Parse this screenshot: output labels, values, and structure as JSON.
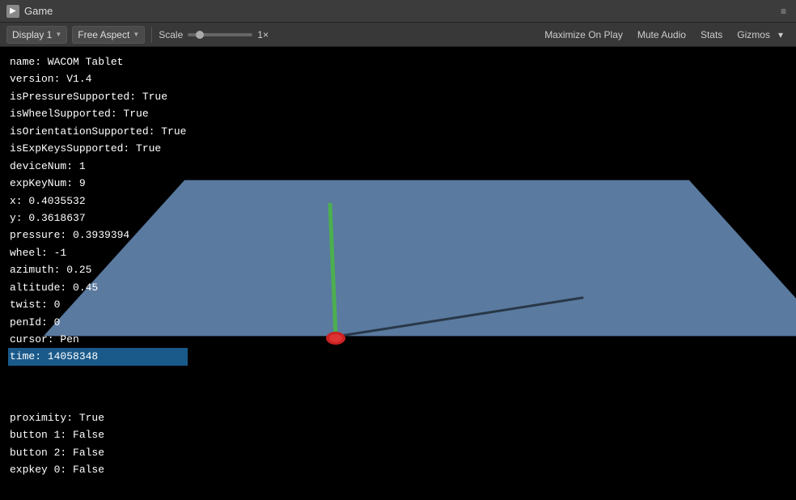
{
  "titleBar": {
    "icon": "▶",
    "title": "Game",
    "controls": "≡"
  },
  "toolbar": {
    "display": "Display 1",
    "aspect": "Free Aspect",
    "scaleLabel": "Scale",
    "scaleValue": "1×",
    "buttons": [
      "Maximize On Play",
      "Mute Audio",
      "Stats",
      "Gizmos"
    ]
  },
  "debugLines": [
    {
      "text": "name: WACOM Tablet",
      "highlighted": false
    },
    {
      "text": "version: V1.4",
      "highlighted": false
    },
    {
      "text": "isPressureSupported: True",
      "highlighted": false
    },
    {
      "text": "isWheelSupported: True",
      "highlighted": false
    },
    {
      "text": "isOrientationSupported: True",
      "highlighted": false
    },
    {
      "text": "isExpKeysSupported: True",
      "highlighted": false
    },
    {
      "text": "deviceNum: 1",
      "highlighted": false
    },
    {
      "text": "expKeyNum: 9",
      "highlighted": false
    },
    {
      "text": "x: 0.4035532",
      "highlighted": false
    },
    {
      "text": "y: 0.3618637",
      "highlighted": false
    },
    {
      "text": "pressure: 0.3939394",
      "highlighted": false
    },
    {
      "text": "wheel: -1",
      "highlighted": false
    },
    {
      "text": "azimuth: 0.25",
      "highlighted": false
    },
    {
      "text": "altitude: 0.45",
      "highlighted": false
    },
    {
      "text": "twist: 0",
      "highlighted": false
    },
    {
      "text": "penId: 0",
      "highlighted": false
    },
    {
      "text": "cursor: Pen",
      "highlighted": false
    },
    {
      "text": "time: 14058348",
      "highlighted": true
    }
  ],
  "bottomLines": [
    "proximity: True",
    "button 1: False",
    "button 2: False",
    "expkey 0: False"
  ],
  "colors": {
    "tabletSurface": "#5a7aa0",
    "penGreen": "#4caf50",
    "penTip": "#cc2222",
    "shadow": "rgba(0,0,0,0.5)",
    "highlight": "#1a5a8a"
  }
}
